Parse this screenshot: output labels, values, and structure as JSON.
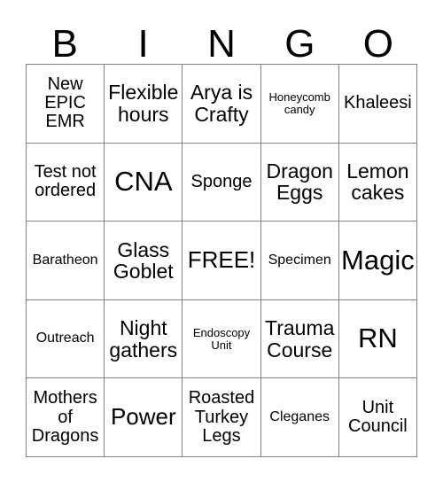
{
  "card": {
    "title": "BINGO",
    "header_letters": [
      "B",
      "I",
      "N",
      "G",
      "O"
    ],
    "border_color": "#808080",
    "text_color": "#000000",
    "background_color": "#ffffff",
    "rows": 5,
    "columns": 5,
    "free_space_label": "FREE!",
    "free_space_position": "row3-col3",
    "cells": [
      [
        {
          "text": "New EPIC EMR",
          "size": "md"
        },
        {
          "text": "Flexible hours",
          "size": "lg"
        },
        {
          "text": "Arya is Crafty",
          "size": "lg"
        },
        {
          "text": "Honeycomb candy",
          "size": "xs"
        },
        {
          "text": "Khaleesi",
          "size": "md"
        }
      ],
      [
        {
          "text": "Test not ordered",
          "size": "md"
        },
        {
          "text": "CNA",
          "size": "xxl"
        },
        {
          "text": "Sponge",
          "size": "md"
        },
        {
          "text": "Dragon Eggs",
          "size": "lg"
        },
        {
          "text": "Lemon cakes",
          "size": "lg"
        }
      ],
      [
        {
          "text": "Baratheon",
          "size": "sm"
        },
        {
          "text": "Glass Goblet",
          "size": "lg"
        },
        {
          "text": "FREE!",
          "size": "xl"
        },
        {
          "text": "Specimen",
          "size": "sm"
        },
        {
          "text": "Magic",
          "size": "xxl"
        }
      ],
      [
        {
          "text": "Outreach",
          "size": "sm"
        },
        {
          "text": "Night gathers",
          "size": "lg"
        },
        {
          "text": "Endoscopy Unit",
          "size": "xs"
        },
        {
          "text": "Trauma Course",
          "size": "lg"
        },
        {
          "text": "RN",
          "size": "xxl"
        }
      ],
      [
        {
          "text": "Mothers of Dragons",
          "size": "md"
        },
        {
          "text": "Power",
          "size": "xl"
        },
        {
          "text": "Roasted Turkey Legs",
          "size": "md"
        },
        {
          "text": "Cleganes",
          "size": "sm"
        },
        {
          "text": "Unit Council",
          "size": "md"
        }
      ]
    ]
  }
}
